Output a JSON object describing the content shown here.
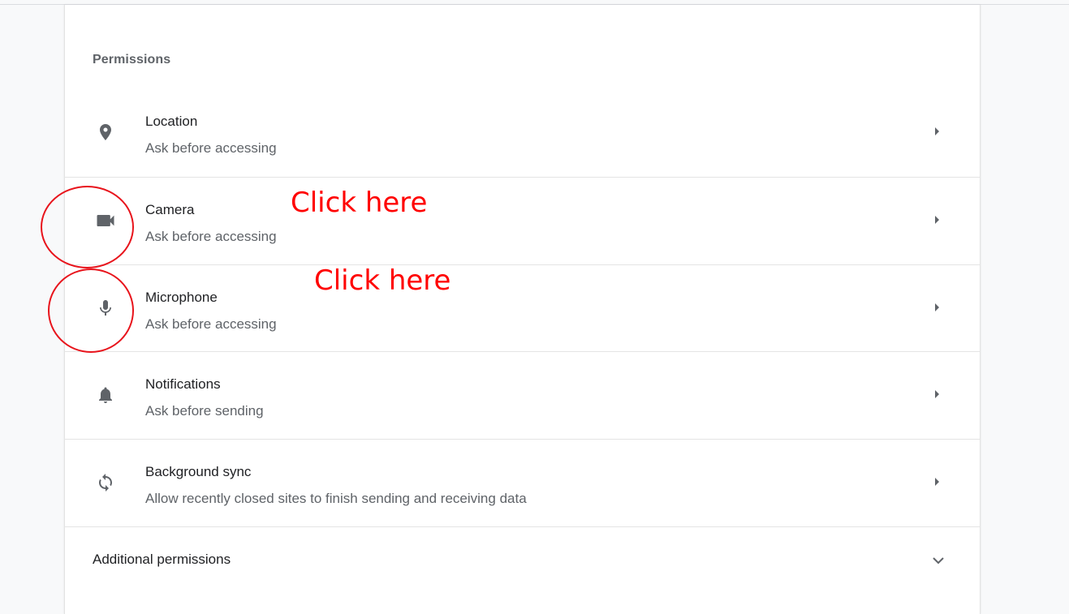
{
  "section": {
    "title": "Permissions"
  },
  "permissions": [
    {
      "title": "Location",
      "subtitle": "Ask before accessing",
      "icon": "location-pin-icon"
    },
    {
      "title": "Camera",
      "subtitle": "Ask before accessing",
      "icon": "videocam-icon"
    },
    {
      "title": "Microphone",
      "subtitle": "Ask before accessing",
      "icon": "mic-icon"
    },
    {
      "title": "Notifications",
      "subtitle": "Ask before sending",
      "icon": "bell-icon"
    },
    {
      "title": "Background sync",
      "subtitle": "Allow recently closed sites to finish sending and receiving data",
      "icon": "sync-icon"
    }
  ],
  "additional": {
    "label": "Additional permissions"
  },
  "annotations": {
    "camera_hint": "Click here",
    "microphone_hint": "Click here",
    "color": "#ff0000"
  },
  "colors": {
    "icon": "#5f6368",
    "title_text": "#202124",
    "secondary_text": "#5f6368",
    "page_background": "#f8f9fa",
    "card_background": "#ffffff"
  }
}
